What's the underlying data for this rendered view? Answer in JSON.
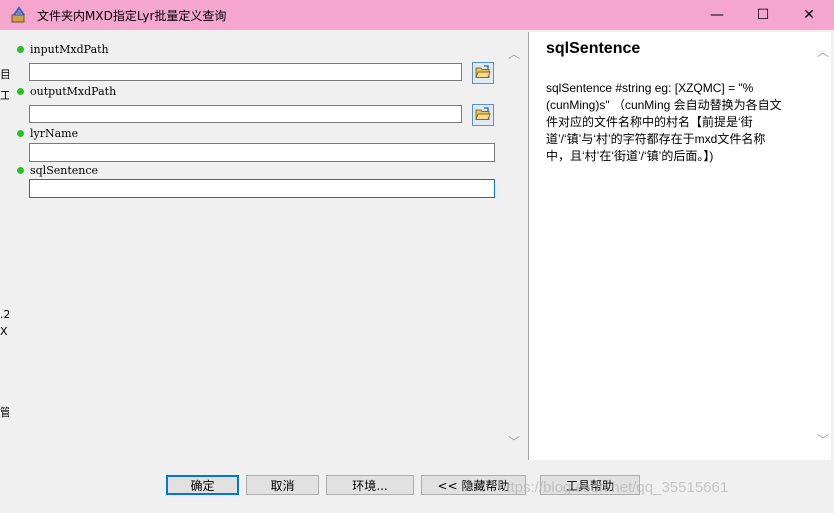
{
  "window": {
    "title": "文件夹内MXD指定Lyr批量定义查询",
    "minimize_symbol": "—",
    "maximize_symbol": "☐",
    "close_symbol": "✕"
  },
  "background_fragments": [
    "目",
    "工",
    ".2",
    "X",
    "管"
  ],
  "params": [
    {
      "label": "inputMxdPath",
      "value": "",
      "has_browse": true
    },
    {
      "label": "outputMxdPath",
      "value": "",
      "has_browse": true
    },
    {
      "label": "lyrName",
      "value": "",
      "has_browse": false
    },
    {
      "label": "sqlSentence",
      "value": "",
      "has_browse": false
    }
  ],
  "help": {
    "title": "sqlSentence",
    "body": "sqlSentence #string eg: [XZQMC] = \"%(cunMing)s\" （cunMing 会自动替换为各自文件对应的文件名称中的村名【前提是‘街道’/‘镇’与‘村’的字符都存在于mxd文件名称中，且‘村’在‘街道’/‘镇’的后面。】)"
  },
  "buttons": {
    "ok": "确定",
    "cancel": "取消",
    "environments": "环境...",
    "hide_help": "<< 隐藏帮助",
    "tool_help": "工具帮助"
  },
  "watermark": "https://blog.csdn.net/qq_35515661",
  "colors": {
    "titlebar": "#f4a6cf",
    "required_dot": "#22c322",
    "focus_border": "#0078d7"
  }
}
